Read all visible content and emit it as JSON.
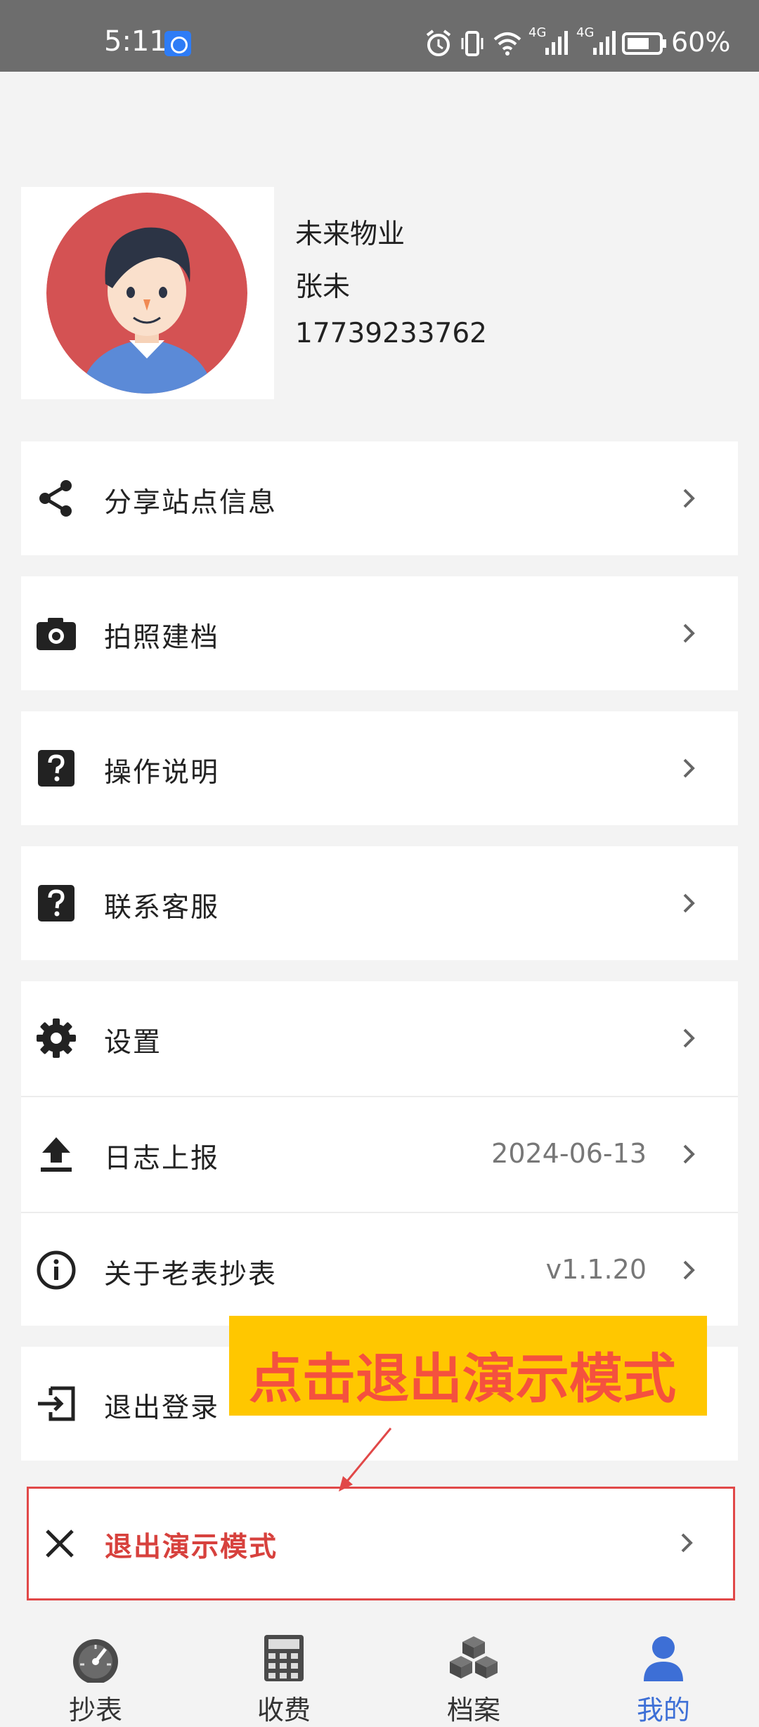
{
  "status_bar": {
    "time": "5:11",
    "battery": "60%",
    "network_1": "4G",
    "network_2": "4G"
  },
  "profile": {
    "company": "未来物业",
    "name": "张未",
    "phone": "17739233762"
  },
  "menu": {
    "share": {
      "label": "分享站点信息",
      "icon": "share-icon"
    },
    "photo": {
      "label": "拍照建档",
      "icon": "camera-icon"
    },
    "guide": {
      "label": "操作说明",
      "icon": "help-icon"
    },
    "support": {
      "label": "联系客服",
      "icon": "help-icon"
    },
    "settings": {
      "label": "设置",
      "icon": "gear-icon"
    },
    "log": {
      "label": "日志上报",
      "value": "2024-06-13",
      "icon": "upload-icon"
    },
    "about": {
      "label": "关于老表抄表",
      "value": "v1.1.20",
      "icon": "info-icon"
    },
    "logout": {
      "label": "退出登录",
      "icon": "logout-icon"
    },
    "exit_demo": {
      "label": "退出演示模式",
      "icon": "close-icon"
    }
  },
  "annotation": {
    "callout_text": "点击退出演示模式",
    "highlight_color": "#e14848",
    "callout_bg": "#ffc700"
  },
  "tabs": [
    {
      "label": "抄表",
      "icon": "gauge-icon"
    },
    {
      "label": "收费",
      "icon": "calculator-icon"
    },
    {
      "label": "档案",
      "icon": "boxes-icon"
    },
    {
      "label": "我的",
      "icon": "user-icon",
      "active": true
    }
  ]
}
